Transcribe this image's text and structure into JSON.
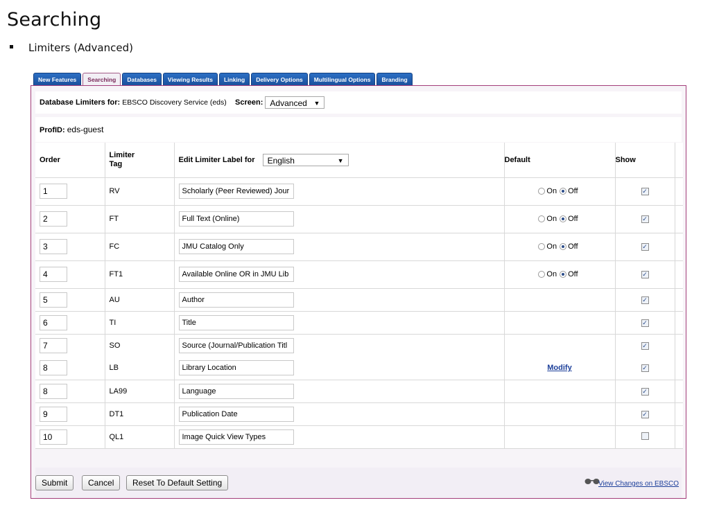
{
  "slide": {
    "title": "Searching",
    "bullet": "Limiters (Advanced)"
  },
  "tabs": [
    {
      "label": "New Features"
    },
    {
      "label": "Searching",
      "active": true
    },
    {
      "label": "Databases"
    },
    {
      "label": "Viewing Results"
    },
    {
      "label": "Linking"
    },
    {
      "label": "Delivery Options"
    },
    {
      "label": "Multilingual Options"
    },
    {
      "label": "Branding"
    }
  ],
  "db_limiters": {
    "label": "Database Limiters for:",
    "value": "EBSCO Discovery Service (eds)",
    "screen_label": "Screen:",
    "screen_value": "Advanced"
  },
  "profile": {
    "label": "ProfID:",
    "value": "eds-guest"
  },
  "table": {
    "headers": {
      "order": "Order",
      "tag": "Limiter Tag",
      "edit": "Edit Limiter Label for",
      "language": "English",
      "default": "Default",
      "show": "Show"
    },
    "rows": [
      {
        "order": "1",
        "tag": "RV",
        "label": "Scholarly (Peer Reviewed) Jour",
        "default": "off",
        "show": true
      },
      {
        "order": "2",
        "tag": "FT",
        "label": "Full Text (Online)",
        "default": "off",
        "show": true
      },
      {
        "order": "3",
        "tag": "FC",
        "label": "JMU Catalog Only",
        "default": "off",
        "show": true
      },
      {
        "order": "4",
        "tag": "FT1",
        "label": "Available Online OR in JMU Lib",
        "default": "off",
        "show": true
      },
      {
        "order": "5",
        "tag": "AU",
        "label": "Author",
        "show": true
      },
      {
        "order": "6",
        "tag": "TI",
        "label": "Title",
        "show": true
      },
      {
        "order": "7",
        "tag": "SO",
        "label": "Source (Journal/Publication Titl",
        "show": true
      },
      {
        "order": "8",
        "tag": "LB",
        "label": "Library Location",
        "show": true,
        "modify": "Modify"
      },
      {
        "order": "8",
        "tag": "LA99",
        "label": "Language",
        "show": true
      },
      {
        "order": "9",
        "tag": "DT1",
        "label": "Publication Date",
        "show": true
      },
      {
        "order": "10",
        "tag": "QL1",
        "label": "Image Quick View Types",
        "show": false
      }
    ],
    "radio_on": "On",
    "radio_off": "Off"
  },
  "footer": {
    "submit": "Submit",
    "cancel": "Cancel",
    "reset": "Reset To Default Setting",
    "view_changes": "View Changes on EBSCO"
  }
}
